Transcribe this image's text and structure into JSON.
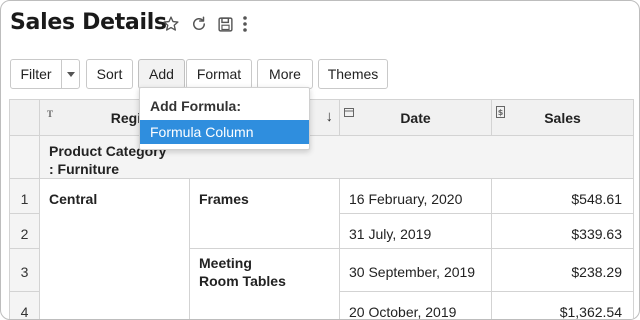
{
  "header": {
    "title": "Sales Details",
    "icons": [
      "star-icon",
      "refresh-icon",
      "save-icon",
      "more-vertical-icon"
    ]
  },
  "toolbar": {
    "filter_label": "Filter",
    "sort_label": "Sort",
    "add_label": "Add",
    "format_label": "Format",
    "more_label": "More",
    "themes_label": "Themes"
  },
  "dropdown": {
    "heading": "Add Formula:",
    "items": [
      {
        "label": "Formula Column",
        "selected": true
      }
    ]
  },
  "table": {
    "columns": [
      {
        "label": "Region",
        "type_icon": "text-type-icon"
      },
      {
        "label": "",
        "type_icon": ""
      },
      {
        "label": "Date",
        "type_icon": "calendar-type-icon"
      },
      {
        "label": "Sales",
        "type_icon": "currency-type-icon"
      }
    ],
    "group_label": "Product Category : Furniture",
    "rows": [
      {
        "index": "1",
        "region": "Central",
        "product": "Frames",
        "date": "16 February, 2020",
        "sales": "$548.61"
      },
      {
        "index": "2",
        "region": "",
        "product": "",
        "date": "31 July, 2019",
        "sales": "$339.63"
      },
      {
        "index": "3",
        "region": "",
        "product": "Meeting Room Tables",
        "date": "30 September, 2019",
        "sales": "$238.29"
      },
      {
        "index": "4",
        "region": "",
        "product": "",
        "date": "20 October, 2019",
        "sales": "$1,362.54"
      }
    ]
  },
  "colors": {
    "accent": "#2f8ede",
    "header_bg": "#f1f1f1",
    "border": "#d3d3d3"
  }
}
